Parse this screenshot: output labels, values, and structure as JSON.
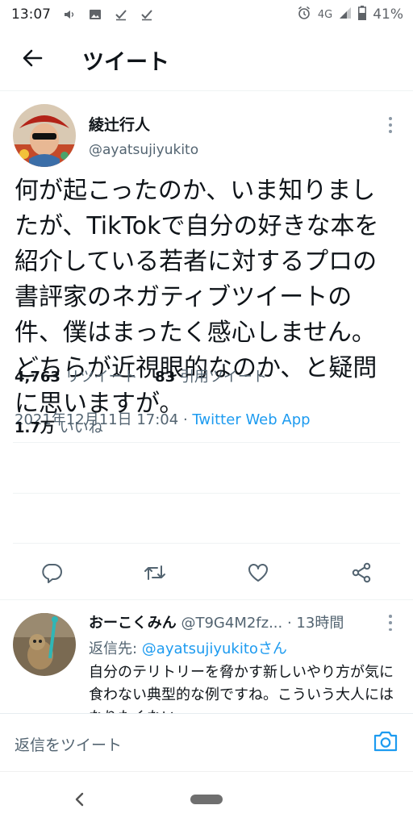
{
  "status_bar": {
    "time": "13:07",
    "network": "4G",
    "battery": "41%",
    "icons": [
      "volume-icon",
      "image-icon",
      "check-icon",
      "check-icon",
      "alarm-icon",
      "signal-icon",
      "battery-icon"
    ]
  },
  "header": {
    "title": "ツイート",
    "back_icon": "arrow-left-icon"
  },
  "tweet": {
    "author_name": "綾辻行人",
    "author_handle": "@ayatsujiyukito",
    "text": "何が起こったのか、いま知りましたが、TikTokで自分の好きな本を紹介している若者に対するプロの書評家のネガティブツイートの件、僕はまったく感心しません。どちらが近視眼的なのか、と疑問に思いますが。",
    "timestamp": "2021年12月11日 17:04",
    "separator": " · ",
    "source": "Twitter Web App",
    "retweets_count": "4,763",
    "retweets_label": "リツイート",
    "quotes_count": "83",
    "quotes_label": "引用ツイート",
    "likes_count": "1.7万",
    "likes_label": "いいね"
  },
  "actions": [
    "reply-icon",
    "retweet-icon",
    "like-icon",
    "share-icon"
  ],
  "reply": {
    "name": "おーこくみん",
    "handle": "@T9G4M2fz...",
    "time": "· 13時間",
    "replying_prefix": "返信先: ",
    "replying_to": "@ayatsujiyukitoさん",
    "text": "自分のテリトリーを脅かす新しいやり方が気に食わない典型的な例ですね。こういう大人にはなりたくない。"
  },
  "composer": {
    "placeholder": "返信をツイート",
    "camera_icon": "camera-icon"
  },
  "colors": {
    "accent": "#1d9bf0",
    "text": "#0f1419",
    "secondary": "#536471",
    "divider": "#eff3f4"
  }
}
